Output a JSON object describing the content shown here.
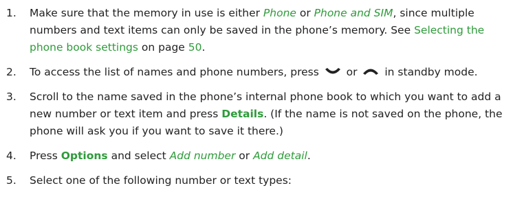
{
  "steps": [
    {
      "number": "1.",
      "t1": "Make sure that the memory in use is either ",
      "phone": "Phone",
      "t2": " or ",
      "phone_and_sim": "Phone and SIM",
      "t3": ", since multiple numbers and text items can only be saved in the phone’s memory. See ",
      "link": "Selecting the phone book settings",
      "t4": " on page ",
      "page": "50",
      "t5": "."
    },
    {
      "number": "2.",
      "t1": "To access the list of names and phone numbers, press ",
      "t2": " or ",
      "t3": " in standby mode.",
      "icon_down": "scroll-down-key-icon",
      "icon_up": "scroll-up-key-icon"
    },
    {
      "number": "3.",
      "t1": "Scroll to the name saved in the phone’s internal phone book to which you want to add a new number or text item and press ",
      "details": "Details",
      "t2": ". (If the name is not saved on the phone, the phone will ask you if you want to save it there.)"
    },
    {
      "number": "4.",
      "t1": "Press ",
      "options": "Options",
      "t2": " and select ",
      "add_number": "Add number",
      "t3": " or ",
      "add_detail": "Add detail",
      "t4": "."
    },
    {
      "number": "5.",
      "t1": "Select one of the following number or text types:"
    }
  ],
  "colors": {
    "accent": "#2e9b3a",
    "text": "#222222"
  }
}
